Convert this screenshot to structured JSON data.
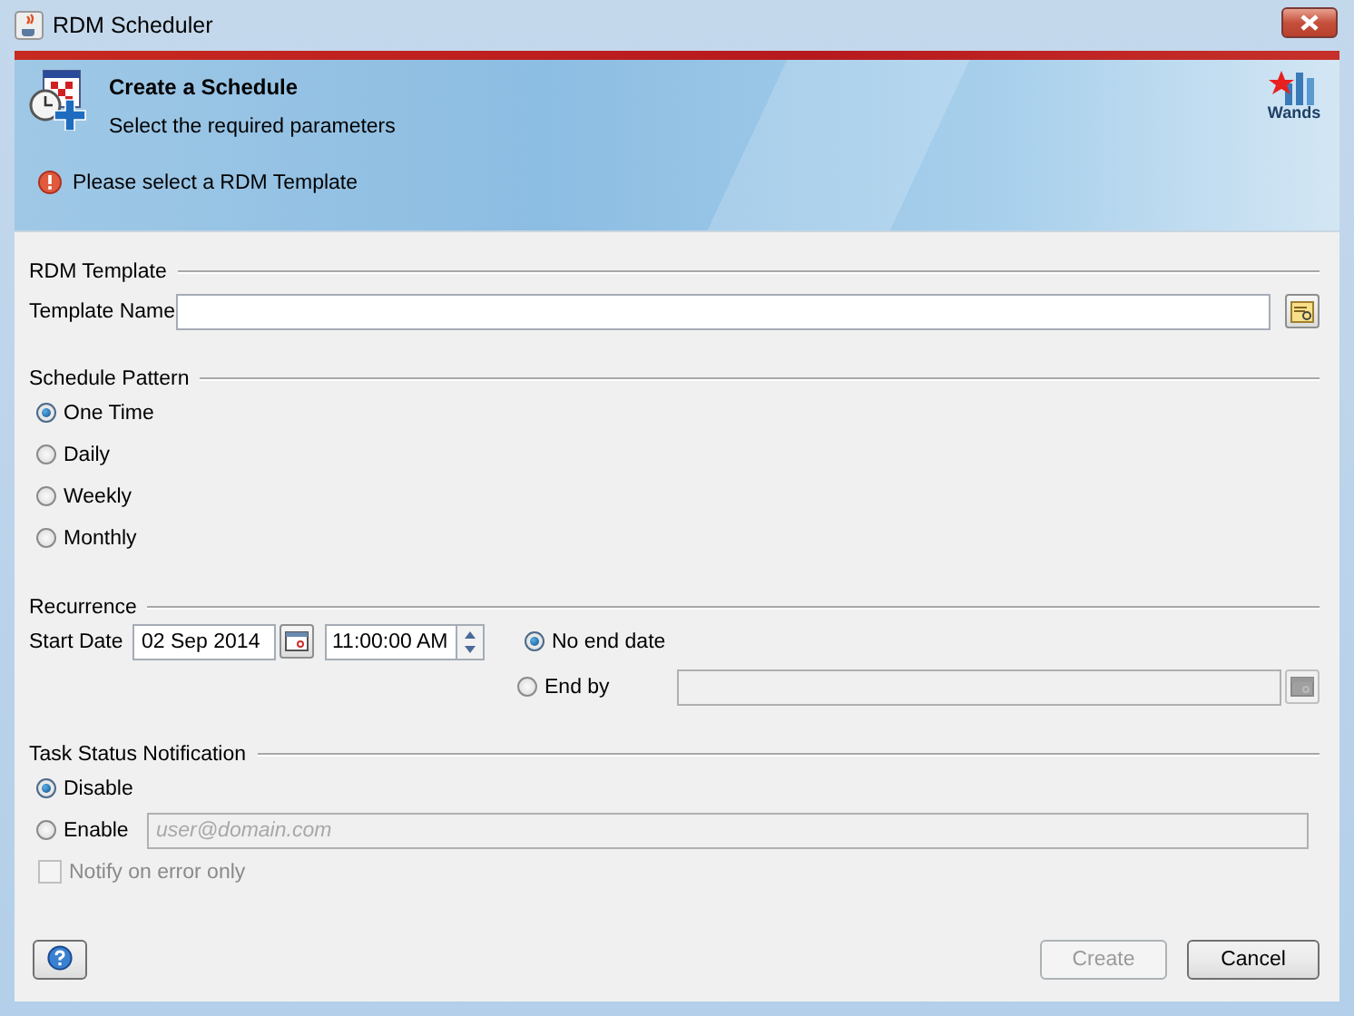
{
  "window": {
    "title": "RDM Scheduler"
  },
  "header": {
    "title": "Create a Schedule",
    "subtitle": "Select the required parameters",
    "logo_text": "Wands",
    "message": "Please select a RDM Template"
  },
  "template": {
    "heading": "RDM Template",
    "label": "Template Name"
  },
  "pattern": {
    "heading": "Schedule Pattern",
    "options": [
      {
        "label": "One Time",
        "selected": true
      },
      {
        "label": "Daily",
        "selected": false
      },
      {
        "label": "Weekly",
        "selected": false
      },
      {
        "label": "Monthly",
        "selected": false
      }
    ]
  },
  "recurrence": {
    "heading": "Recurrence",
    "start_label": "Start Date",
    "start_date": "02 Sep 2014",
    "start_time": "11:00:00 AM",
    "end_options": [
      {
        "label": "No end date",
        "selected": true
      },
      {
        "label": "End by",
        "selected": false
      }
    ],
    "end_by_disabled": true
  },
  "notification": {
    "heading": "Task Status Notification",
    "options": [
      {
        "label": "Disable",
        "selected": true
      },
      {
        "label": "Enable",
        "selected": false
      }
    ],
    "email_placeholder": "user@domain.com",
    "email_disabled": true,
    "error_only": {
      "label": "Notify on error only",
      "checked": false,
      "disabled": true
    }
  },
  "buttons": [
    {
      "label": "Create",
      "disabled": true
    },
    {
      "label": "Cancel",
      "disabled": false
    }
  ]
}
